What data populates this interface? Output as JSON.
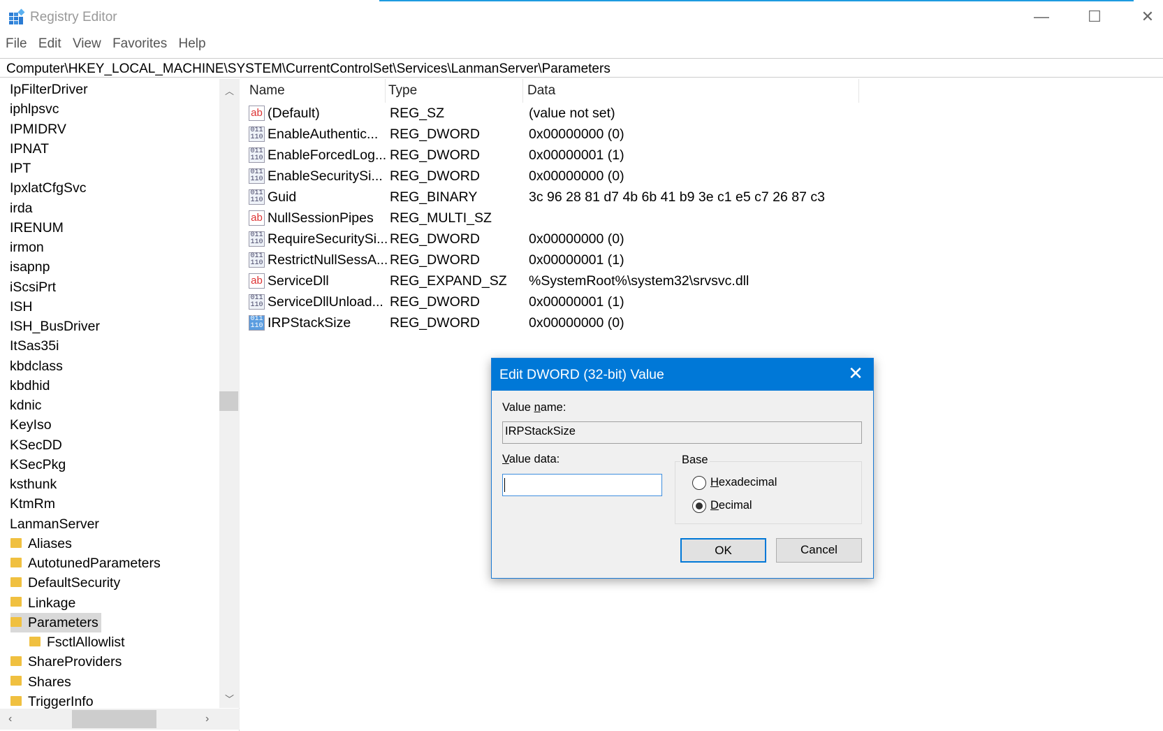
{
  "window": {
    "title": "Registry Editor",
    "minimize": "—",
    "maximize": "☐",
    "close": "✕"
  },
  "menu": [
    "File",
    "Edit",
    "View",
    "Favorites",
    "Help"
  ],
  "address": "Computer\\HKEY_LOCAL_MACHINE\\SYSTEM\\CurrentControlSet\\Services\\LanmanServer\\Parameters",
  "tree": {
    "top_items": [
      "IpFilterDriver",
      "iphlpsvc",
      "IPMIDRV",
      "IPNAT",
      "IPT",
      "IpxlatCfgSvc",
      "irda",
      "IRENUM",
      "irmon",
      "isapnp",
      "iScsiPrt",
      "ISH",
      "ISH_BusDriver",
      "ItSas35i",
      "kbdclass",
      "kbdhid",
      "kdnic",
      "KeyIso",
      "KSecDD",
      "KSecPkg",
      "ksthunk",
      "KtmRm",
      "LanmanServer"
    ],
    "sub_items": [
      "Aliases",
      "AutotunedParameters",
      "DefaultSecurity",
      "Linkage",
      "Parameters",
      "FsctlAllowlist",
      "ShareProviders",
      "Shares",
      "TriggerInfo"
    ],
    "selected": "Parameters"
  },
  "list": {
    "headers": [
      "Name",
      "Type",
      "Data"
    ],
    "rows": [
      {
        "icon": "ab",
        "name": "(Default)",
        "type": "REG_SZ",
        "data": "(value not set)"
      },
      {
        "icon": "bin",
        "name": "EnableAuthentic...",
        "type": "REG_DWORD",
        "data": "0x00000000 (0)"
      },
      {
        "icon": "bin",
        "name": "EnableForcedLog...",
        "type": "REG_DWORD",
        "data": "0x00000001 (1)"
      },
      {
        "icon": "bin",
        "name": "EnableSecuritySi...",
        "type": "REG_DWORD",
        "data": "0x00000000 (0)"
      },
      {
        "icon": "bin",
        "name": "Guid",
        "type": "REG_BINARY",
        "data": "3c 96 28 81 d7 4b 6b 41 b9 3e c1 e5 c7 26 87 c3"
      },
      {
        "icon": "ab",
        "name": "NullSessionPipes",
        "type": "REG_MULTI_SZ",
        "data": ""
      },
      {
        "icon": "bin",
        "name": "RequireSecuritySi...",
        "type": "REG_DWORD",
        "data": "0x00000000 (0)"
      },
      {
        "icon": "bin",
        "name": "RestrictNullSessA...",
        "type": "REG_DWORD",
        "data": "0x00000001 (1)"
      },
      {
        "icon": "ab",
        "name": "ServiceDll",
        "type": "REG_EXPAND_SZ",
        "data": "%SystemRoot%\\system32\\srvsvc.dll"
      },
      {
        "icon": "bin",
        "name": "ServiceDllUnload...",
        "type": "REG_DWORD",
        "data": "0x00000001 (1)"
      },
      {
        "icon": "bin",
        "name": "IRPStackSize",
        "type": "REG_DWORD",
        "data": "0x00000000 (0)"
      }
    ]
  },
  "icon_text": {
    "ab": "ab",
    "bin": "011\n110"
  },
  "dialog": {
    "title": "Edit DWORD (32-bit) Value",
    "value_name_label": "Value name:",
    "value_name": "IRPStackSize",
    "value_data_label": "Value data:",
    "value_data": "",
    "base_label": "Base",
    "hex_label": "Hexadecimal",
    "dec_label": "Decimal",
    "selected_base": "Decimal",
    "ok": "OK",
    "cancel": "Cancel",
    "close": "✕"
  },
  "colors": {
    "accent": "#0078d7",
    "selection": "#d9d9d9"
  }
}
